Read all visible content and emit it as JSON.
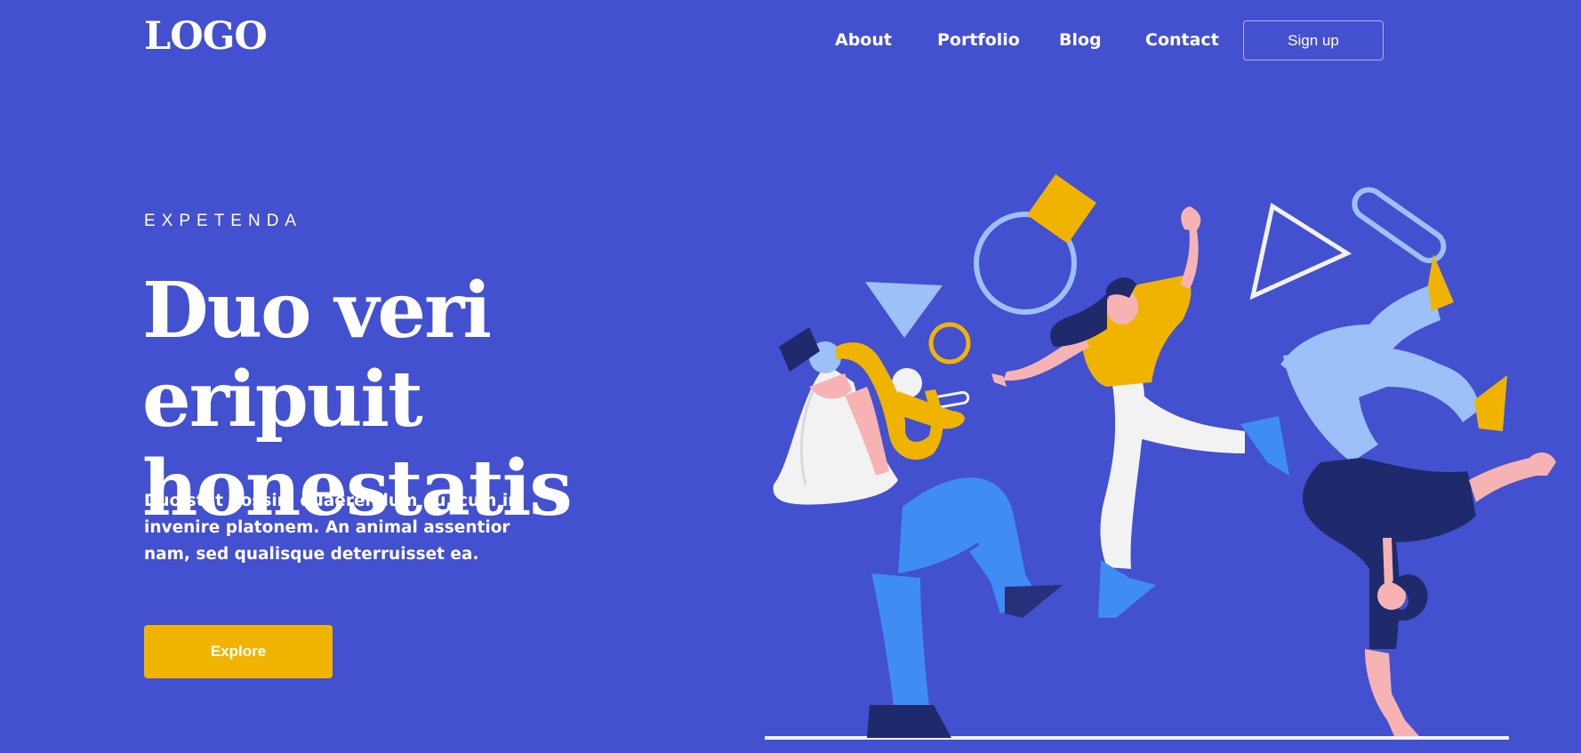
{
  "header": {
    "logo": "LOGO",
    "nav": [
      {
        "label": "About"
      },
      {
        "label": "Portfolio"
      },
      {
        "label": "Blog"
      },
      {
        "label": "Contact"
      }
    ],
    "signup_label": "Sign up"
  },
  "hero": {
    "eyebrow": "EXPETENDA",
    "headline_line1": "Duo veri eripuit",
    "headline_line2": "honestatis",
    "body": "Duo stet possim quaerendum eu, cum in invenire platonem. An animal assentior nam, sed qualisque deterruisset ea.",
    "cta_label": "Explore"
  },
  "colors": {
    "background": "#4350cf",
    "accent": "#f0b400",
    "light_blue": "#9cc0f7",
    "bright_blue": "#3f8cf5",
    "navy": "#1e2a6b",
    "skin": "#f7b3b3",
    "white": "#f2f2f2"
  },
  "illustration": {
    "icons": [
      "saxophone-player-figure",
      "dancer-figure",
      "handstand-dancer-figure",
      "geometric-shapes"
    ]
  }
}
